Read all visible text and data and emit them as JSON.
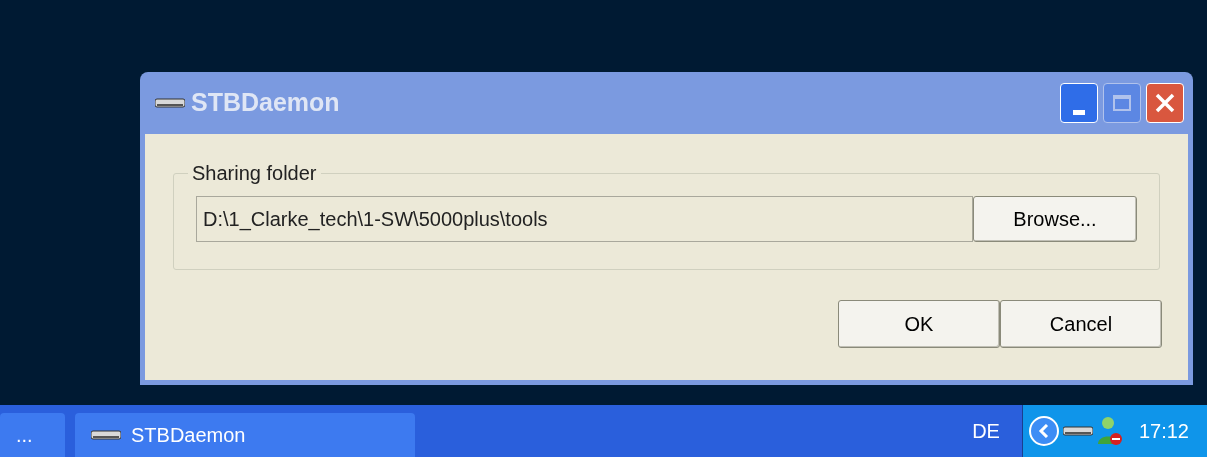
{
  "window": {
    "title": "STBDaemon",
    "title_buttons": [
      {
        "kind": "minimize",
        "disabled": false
      },
      {
        "kind": "maximize",
        "disabled": true
      },
      {
        "kind": "close",
        "disabled": false
      }
    ]
  },
  "group": {
    "label": "Sharing folder",
    "path": "D:\\1_Clarke_tech\\1-SW\\5000plus\\tools",
    "browse_button": "Browse..."
  },
  "buttons": [
    "OK",
    "Cancel"
  ],
  "taskbar": {
    "items": [
      {
        "label": "...",
        "kind": "overflow"
      },
      {
        "label": "STBDaemon",
        "kind": "app"
      }
    ],
    "language": "DE",
    "clock": "17:12"
  }
}
